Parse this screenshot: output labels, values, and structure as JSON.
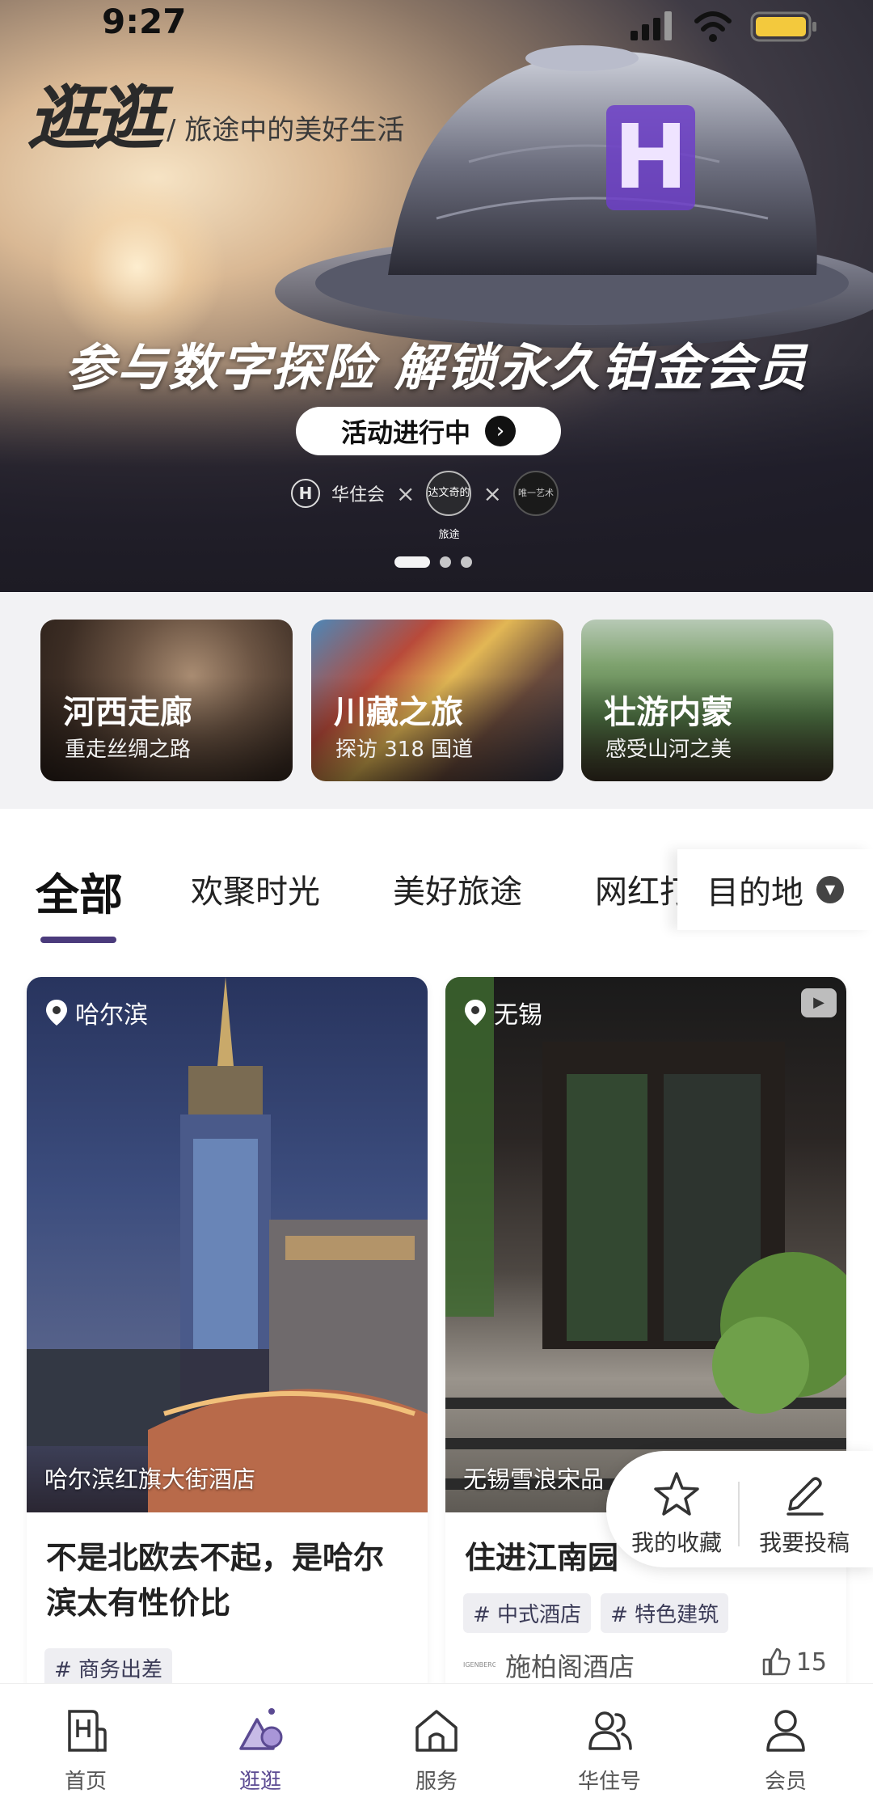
{
  "status_bar": {
    "time": "9:27"
  },
  "hero": {
    "brand": {
      "logo": "逛逛",
      "subtitle": "/ 旅途中的美好生活"
    },
    "headline": "参与数字探险 解锁永久铂金会员",
    "cta": "活动进行中",
    "partners": {
      "huazhu": "华住会",
      "davinci": "达文奇的旅途",
      "other": "唯一艺术"
    },
    "carousel": {
      "count": 3,
      "active": 1
    }
  },
  "themes": [
    {
      "title": "河西走廊",
      "subtitle": "重走丝绸之路"
    },
    {
      "title": "川藏之旅",
      "subtitle": "探访 318 国道"
    },
    {
      "title": "壮游内蒙",
      "subtitle": "感受山河之美"
    }
  ],
  "tabs": {
    "items": [
      {
        "label": "全部",
        "active": true
      },
      {
        "label": "欢聚时光"
      },
      {
        "label": "美好旅途"
      },
      {
        "label": "网红打"
      }
    ],
    "destination": "目的地"
  },
  "posts": [
    {
      "location": "哈尔滨",
      "hotel": "哈尔滨红旗大街酒店",
      "title": "不是北欧去不起，是哈尔滨太有性价比",
      "tags": [
        "# 商务出差"
      ]
    },
    {
      "location": "无锡",
      "hotel": "无锡雪浪宋品",
      "title": "住进江南园",
      "tags": [
        "# 中式酒店",
        "# 特色建筑"
      ],
      "brand_logo": "IGENBERG",
      "brand": "施柏阁酒店",
      "likes": "15"
    }
  ],
  "float_actions": {
    "favorites": "我的收藏",
    "submit": "我要投稿"
  },
  "bottom_nav": [
    {
      "label": "首页",
      "icon": "home-h-icon"
    },
    {
      "label": "逛逛",
      "icon": "explore-icon",
      "active": true
    },
    {
      "label": "服务",
      "icon": "service-house-icon"
    },
    {
      "label": "华住号",
      "icon": "people-icon"
    },
    {
      "label": "会员",
      "icon": "member-icon"
    }
  ],
  "colors": {
    "accent": "#5b4a92",
    "brand_red": "#d6342a"
  }
}
